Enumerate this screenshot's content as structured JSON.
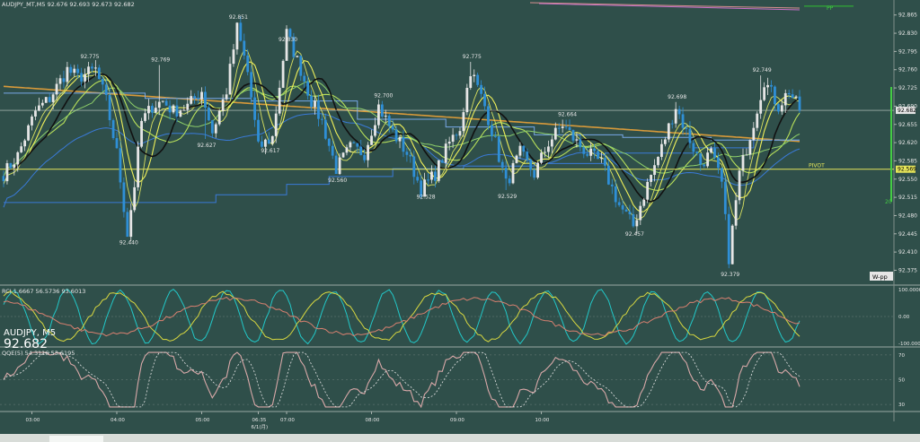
{
  "header": {
    "text": "AUDJPY_MT,M5  92.676 92.693 92.673 92.682"
  },
  "symbol": {
    "name": "AUDJPY, M5",
    "last": "92.682"
  },
  "indicators": {
    "rci_label": "RCI 1.6667 56.5736 93.6013",
    "qqe_label": "QQE(5) 54.3116 53.6195",
    "rci_axis": [
      "100.0000",
      "0.00",
      "-100.0000"
    ],
    "qqe_axis": [
      "70",
      "50",
      "30"
    ]
  },
  "colors": {
    "background": "#2f4f4a",
    "bull": "#e6e6e6",
    "bear": "#2f8fd6",
    "ma_black": "#111111",
    "ma_yellow": "#f0f05a",
    "ma_green": "#b8e05a",
    "ma_blue": "#3a7ad8",
    "ma_lightblue": "#78a8e8",
    "ma_orange": "#d89a3a",
    "pivot": "#e6e65a",
    "rci_cyan": "#22c8c8",
    "rci_yellow": "#d8d840",
    "rci_salmon": "#d88070",
    "qqe_line": "#d8a8a8"
  },
  "chart_data": {
    "type": "candlestick",
    "symbol": "AUDJPY",
    "timeframe": "M5",
    "ylim": [
      92.35,
      92.88
    ],
    "y_ticks": [
      "92.865",
      "92.830",
      "92.795",
      "92.760",
      "92.725",
      "92.690",
      "92.655",
      "92.620",
      "92.585",
      "92.550",
      "92.515",
      "92.480",
      "92.445",
      "92.410",
      "92.375"
    ],
    "x_ticks": [
      "03:00",
      "04:00",
      "05:00",
      "06:35",
      "07:00",
      "08:00",
      "09:00",
      "10:00"
    ],
    "x_date": "6/1(月)",
    "price_path": [
      [
        0,
        92.56
      ],
      [
        4,
        92.595
      ],
      [
        9,
        92.68
      ],
      [
        13,
        92.705
      ],
      [
        18,
        92.76
      ],
      [
        21,
        92.745
      ],
      [
        26,
        92.76
      ],
      [
        29,
        92.7
      ],
      [
        32,
        92.6
      ],
      [
        35,
        92.445
      ],
      [
        37,
        92.54
      ],
      [
        39,
        92.66
      ],
      [
        42,
        92.69
      ],
      [
        45,
        92.7
      ],
      [
        48,
        92.68
      ],
      [
        52,
        92.69
      ],
      [
        56,
        92.72
      ],
      [
        59,
        92.64
      ],
      [
        63,
        92.72
      ],
      [
        66,
        92.84
      ],
      [
        69,
        92.755
      ],
      [
        72,
        92.61
      ],
      [
        76,
        92.63
      ],
      [
        80,
        92.83
      ],
      [
        84,
        92.76
      ],
      [
        87,
        92.7
      ],
      [
        90,
        92.66
      ],
      [
        94,
        92.57
      ],
      [
        98,
        92.61
      ],
      [
        102,
        92.6
      ],
      [
        106,
        92.69
      ],
      [
        110,
        92.64
      ],
      [
        114,
        92.6
      ],
      [
        118,
        92.53
      ],
      [
        122,
        92.56
      ],
      [
        126,
        92.62
      ],
      [
        129,
        92.65
      ],
      [
        132,
        92.76
      ],
      [
        136,
        92.69
      ],
      [
        139,
        92.62
      ],
      [
        142,
        92.54
      ],
      [
        146,
        92.6
      ],
      [
        150,
        92.56
      ],
      [
        154,
        92.62
      ],
      [
        158,
        92.655
      ],
      [
        162,
        92.62
      ],
      [
        165,
        92.6
      ],
      [
        169,
        92.58
      ],
      [
        174,
        92.5
      ],
      [
        178,
        92.46
      ],
      [
        182,
        92.54
      ],
      [
        186,
        92.61
      ],
      [
        190,
        92.69
      ],
      [
        193,
        92.64
      ],
      [
        197,
        92.58
      ],
      [
        200,
        92.6
      ],
      [
        203,
        92.54
      ],
      [
        205,
        92.4
      ],
      [
        208,
        92.56
      ],
      [
        212,
        92.66
      ],
      [
        215,
        92.74
      ],
      [
        219,
        92.69
      ],
      [
        222,
        92.72
      ],
      [
        225,
        92.682
      ]
    ],
    "label_points": [
      {
        "i": 24,
        "value": 92.775
      },
      {
        "i": 44,
        "value": 92.769
      },
      {
        "i": 57,
        "value": 92.627
      },
      {
        "i": 66,
        "value": 92.851
      },
      {
        "i": 75,
        "value": 92.617
      },
      {
        "i": 80,
        "value": 92.83
      },
      {
        "i": 94,
        "value": 92.56
      },
      {
        "i": 107,
        "value": 92.7
      },
      {
        "i": 119,
        "value": 92.528
      },
      {
        "i": 132,
        "value": 92.775
      },
      {
        "i": 142,
        "value": 92.529
      },
      {
        "i": 159,
        "value": 92.664
      },
      {
        "i": 178,
        "value": 92.457
      },
      {
        "i": 190,
        "value": 92.698
      },
      {
        "i": 205,
        "value": 92.379
      },
      {
        "i": 214,
        "value": 92.749
      },
      {
        "i": 35,
        "value": 92.44
      }
    ],
    "levels": {
      "pivot": {
        "label": "PIVOT",
        "value": 92.569
      },
      "pp": {
        "label": "PP",
        "value": 92.882
      },
      "w_pp": {
        "label": "W-pp"
      },
      "current": 92.682
    },
    "price_tags": [
      "92.569",
      "92.682"
    ],
    "range_label": "20",
    "qqe": {
      "ylim": [
        25,
        75
      ]
    },
    "rci": {
      "ylim": [
        -100,
        100
      ]
    }
  }
}
